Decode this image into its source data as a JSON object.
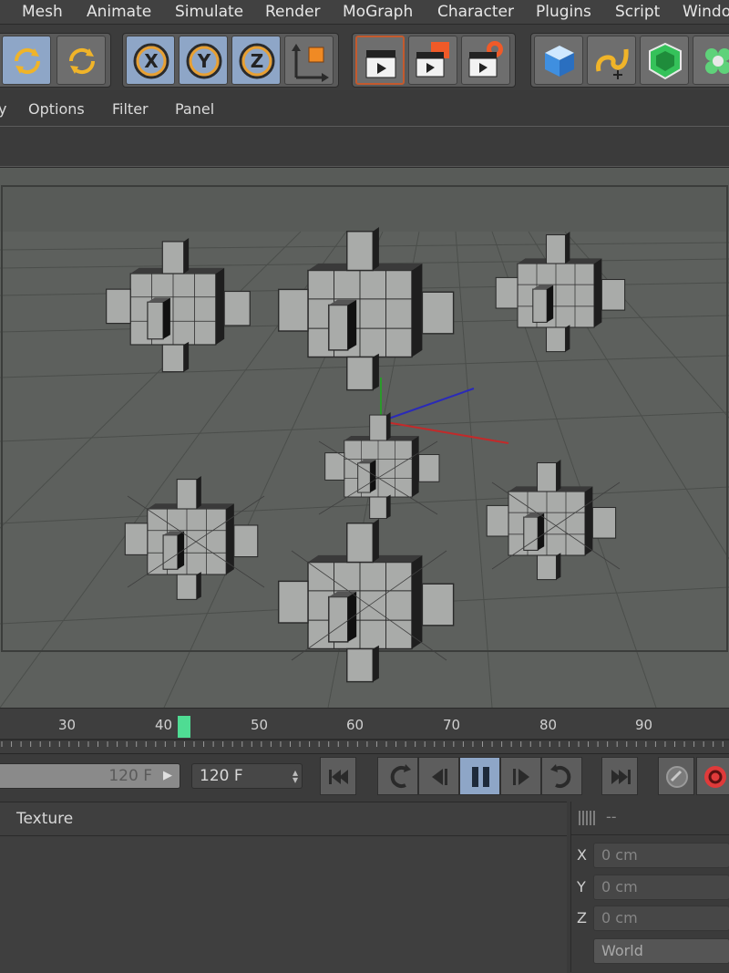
{
  "menubar": {
    "items": [
      "Mesh",
      "Animate",
      "Simulate",
      "Render",
      "MoGraph",
      "Character",
      "Plugins",
      "Script",
      "Windo"
    ]
  },
  "toolbar": {
    "axis_x": "X",
    "axis_y": "Y",
    "axis_z": "Z"
  },
  "viewport_menu": {
    "items": [
      "y",
      "Options",
      "Filter",
      "Panel"
    ]
  },
  "timeline": {
    "ticks": [
      "30",
      "40",
      "50",
      "60",
      "70",
      "80",
      "90"
    ],
    "current_frame": 42
  },
  "transport": {
    "end_frame_value": "120 F",
    "max_frame_value": "120 F"
  },
  "materials": {
    "menu_texture": "Texture"
  },
  "coordinates": {
    "header": "--",
    "x_label": "X",
    "x_value": "0 cm",
    "y_label": "Y",
    "y_value": "0 cm",
    "z_label": "Z",
    "z_value": "0 cm",
    "space": "World"
  },
  "colors": {
    "playhead": "#4fdc93",
    "active_play": "#8ea6c7",
    "record": "#e03a3a"
  }
}
